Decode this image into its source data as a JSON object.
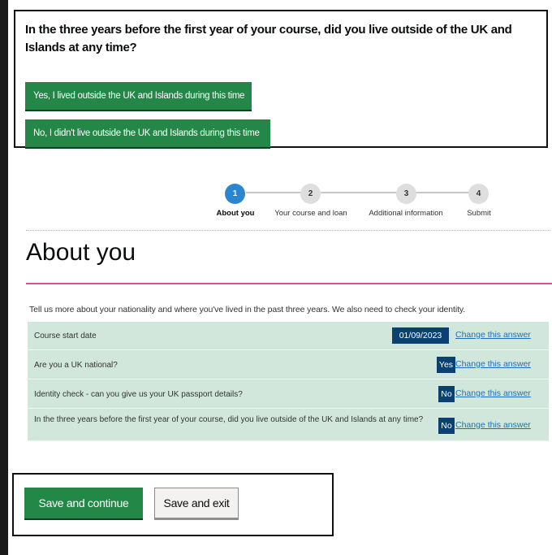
{
  "question": {
    "text": "In the three years before the first year of your course, did you live outside of the UK and Islands at any time?",
    "yes_label": "Yes, I lived outside the UK and Islands during this time",
    "no_label": "No, I didn't live outside the UK and Islands during this time"
  },
  "stepper": {
    "steps": [
      {
        "number": "1",
        "label": "About you"
      },
      {
        "number": "2",
        "label": "Your course and loan"
      },
      {
        "number": "3",
        "label": "Additional information"
      },
      {
        "number": "4",
        "label": "Submit"
      }
    ],
    "active_step": 1
  },
  "page": {
    "heading": "About you",
    "intro": "Tell us more about your nationality and where you've lived in the past three years. We also need to check your identity."
  },
  "summary": {
    "change_label": "Change this answer",
    "rows": [
      {
        "key": "Course start date",
        "value": "01/09/2023"
      },
      {
        "key": "Are you a UK national?",
        "value": "Yes"
      },
      {
        "key": "Identity check - can you give us your UK passport details?",
        "value": "No"
      },
      {
        "key": "In the three years before the first year of your course, did you live outside of the UK and Islands at any time?",
        "value": "No"
      }
    ]
  },
  "actions": {
    "save_continue": "Save and continue",
    "save_exit": "Save and exit"
  },
  "colors": {
    "primary_green": "#228747",
    "summary_background": "#d1e7dc",
    "value_badge": "#0a4170",
    "link_blue": "#1d70b8",
    "active_step": "#2b86cf",
    "accent_rule": "#d4539b"
  }
}
